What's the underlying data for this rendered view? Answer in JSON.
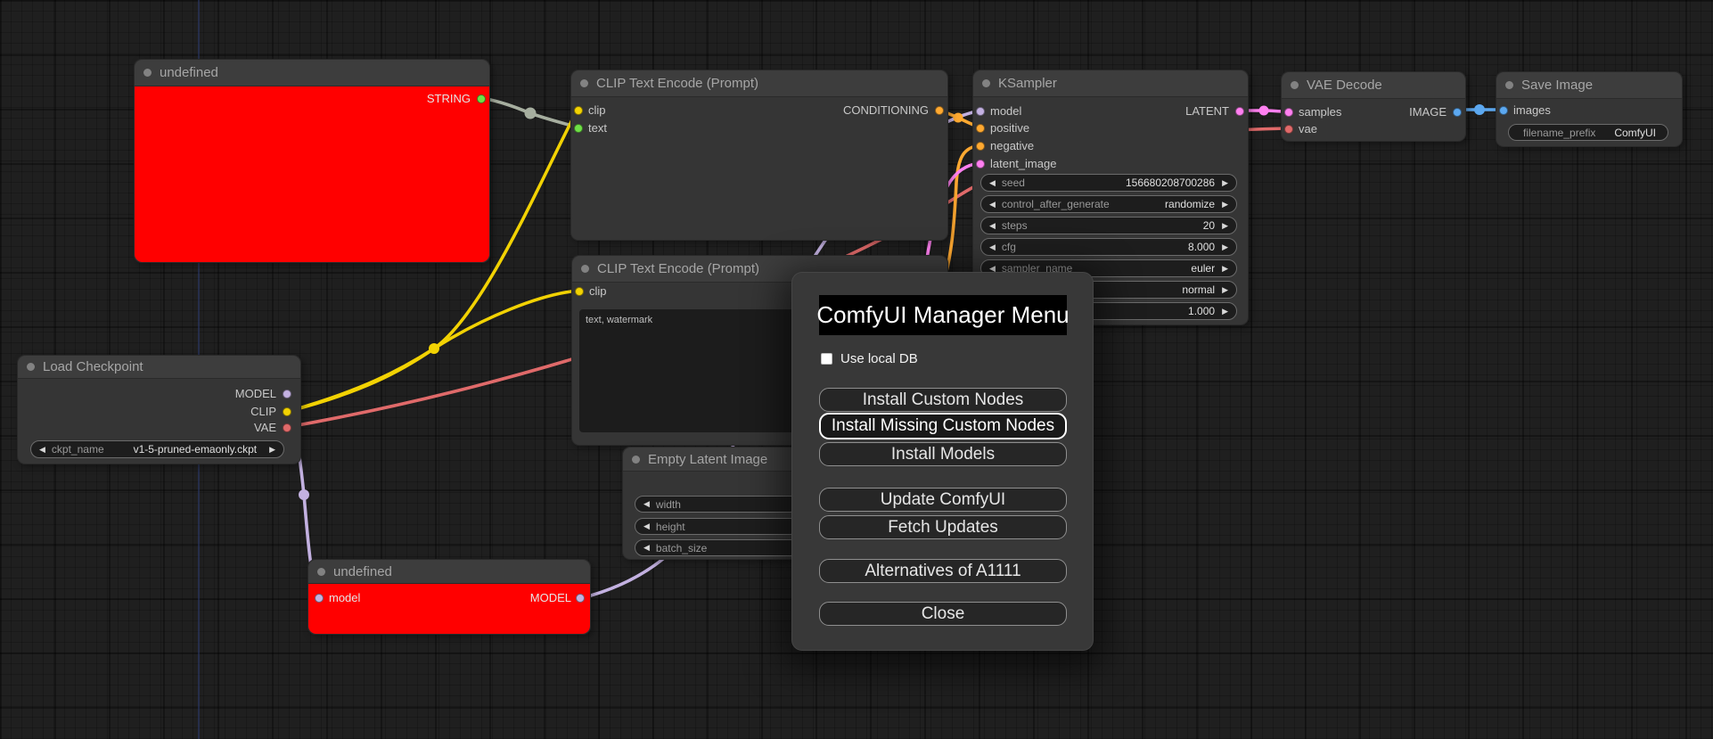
{
  "colors": {
    "background": "#1f1f1f",
    "node_error_bg": "#ff0000",
    "model": "#c3b1e1",
    "clip": "#f2d203",
    "vae": "#e06a6a",
    "conditioning": "#ffa931",
    "latent": "#ff80f0",
    "image": "#5ca8f0",
    "string_dot": "#6ee046",
    "string_wire": "#a6ae9f"
  },
  "ui": {
    "arrow_left": "◀",
    "arrow_right": "▶"
  },
  "nodes": {
    "undefined_top": {
      "title": "undefined",
      "output": "STRING"
    },
    "clip_encode_1": {
      "title": "CLIP Text Encode (Prompt)",
      "input_clip": "clip",
      "input_text": "text",
      "output": "CONDITIONING"
    },
    "clip_encode_2": {
      "title": "CLIP Text Encode (Prompt)",
      "input_clip": "clip",
      "text_value": "text, watermark"
    },
    "ksampler": {
      "title": "KSampler",
      "inputs": {
        "model": "model",
        "positive": "positive",
        "negative": "negative",
        "latent_image": "latent_image"
      },
      "output": "LATENT",
      "widgets": [
        {
          "label": "seed",
          "value": "156680208700286"
        },
        {
          "label": "control_after_generate",
          "value": "randomize"
        },
        {
          "label": "steps",
          "value": "20"
        },
        {
          "label": "cfg",
          "value": "8.000"
        },
        {
          "label": "sampler_name",
          "value": "euler"
        },
        {
          "label": "",
          "value": "normal"
        },
        {
          "label": "",
          "value": "1.000"
        }
      ]
    },
    "vae_decode": {
      "title": "VAE Decode",
      "input_samples": "samples",
      "input_vae": "vae",
      "output": "IMAGE"
    },
    "save_image": {
      "title": "Save Image",
      "input_images": "images",
      "widget": {
        "label": "filename_prefix",
        "value": "ComfyUI"
      }
    },
    "load_checkpoint": {
      "title": "Load Checkpoint",
      "outputs": {
        "model": "MODEL",
        "clip": "CLIP",
        "vae": "VAE"
      },
      "widget": {
        "label": "ckpt_name",
        "value": "v1-5-pruned-emaonly.ckpt"
      }
    },
    "empty_latent": {
      "title": "Empty Latent Image",
      "widgets": [
        {
          "label": "width",
          "value": ""
        },
        {
          "label": "height",
          "value": ""
        },
        {
          "label": "batch_size",
          "value": ""
        }
      ]
    },
    "undefined_bottom": {
      "title": "undefined",
      "input": "model",
      "output": "MODEL"
    }
  },
  "modal": {
    "title": "ComfyUI Manager Menu",
    "checkbox_label": "Use local DB",
    "checkbox_checked": false,
    "buttons": [
      "Install Custom Nodes",
      "Install Missing Custom Nodes",
      "Install Models",
      "Update ComfyUI",
      "Fetch Updates",
      "Alternatives of A1111",
      "Close"
    ]
  }
}
